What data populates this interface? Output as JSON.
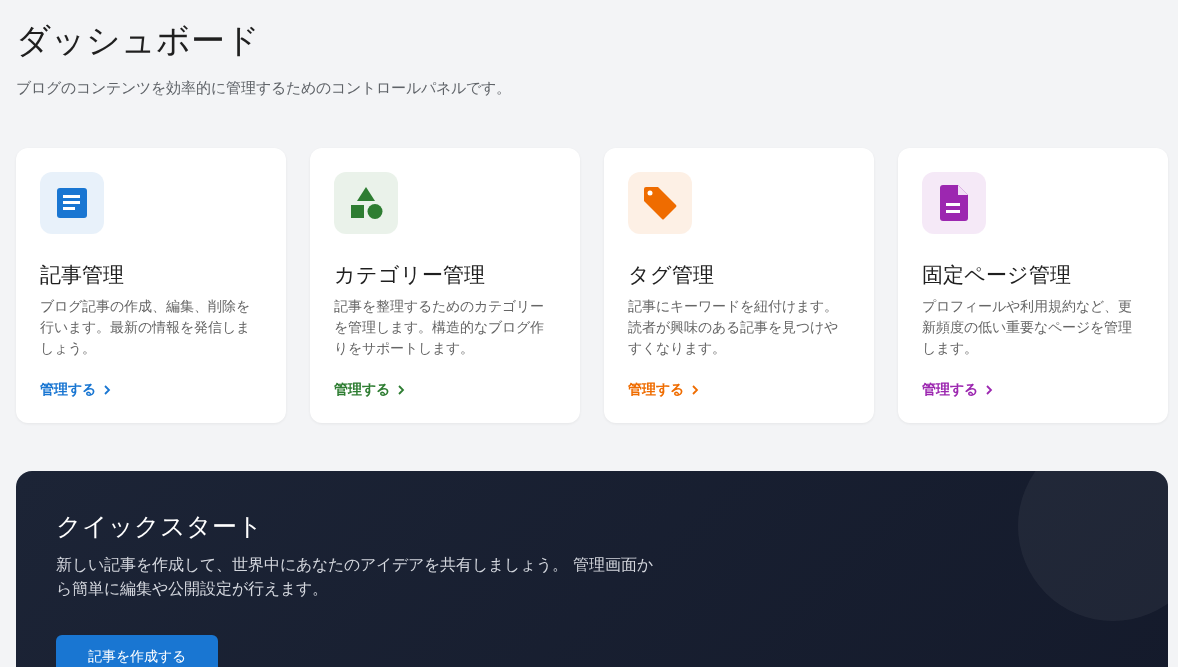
{
  "header": {
    "title": "ダッシュボード",
    "subtitle": "ブログのコンテンツを効率的に管理するためのコントロールパネルです。"
  },
  "cards": [
    {
      "kind": "document",
      "color": "#1976d2",
      "title": "記事管理",
      "description": "ブログ記事の作成、編集、削除を行います。最新の情報を発信しましょう。",
      "link": "管理する"
    },
    {
      "kind": "shapes",
      "color": "#2e7d32",
      "title": "カテゴリー管理",
      "description": "記事を整理するためのカテゴリーを管理します。構造的なブログ作りをサポートします。",
      "link": "管理する"
    },
    {
      "kind": "tag",
      "color": "#ef6c00",
      "title": "タグ管理",
      "description": "記事にキーワードを紐付けます。読者が興味のある記事を見つけやすくなります。",
      "link": "管理する"
    },
    {
      "kind": "page",
      "color": "#9c27b0",
      "title": "固定ページ管理",
      "description": "プロフィールや利用規約など、更新頻度の低い重要なページを管理します。",
      "link": "管理する"
    }
  ],
  "quick_start": {
    "title": "クイックスタート",
    "description": "新しい記事を作成して、世界中にあなたのアイデアを共有しましょう。 管理画面から簡単に編集や公開設定が行えます。",
    "button": "記事を作成する"
  }
}
